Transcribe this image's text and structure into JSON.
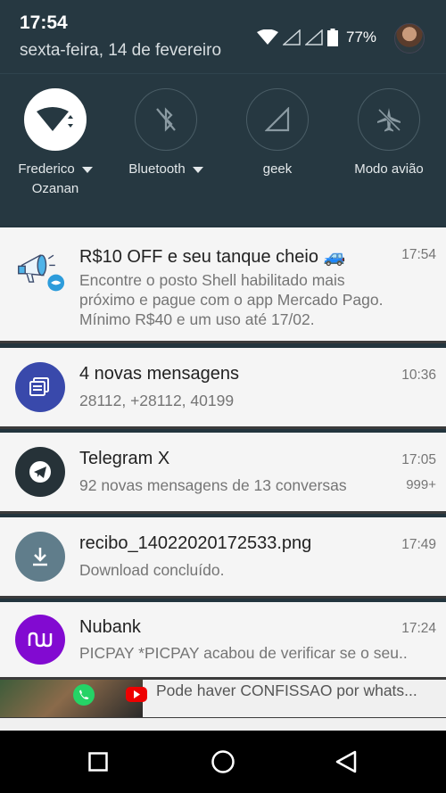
{
  "status_bar": {
    "time": "17:54",
    "date": "sexta-feira, 14 de fevereiro",
    "battery": "77%"
  },
  "quick_settings": {
    "tiles": [
      {
        "label": "Frederico",
        "sublabel": "Ozanan",
        "icon": "wifi-icon",
        "active": true,
        "expandable": true
      },
      {
        "label": "Bluetooth",
        "icon": "bluetooth-off-icon",
        "active": false,
        "expandable": true
      },
      {
        "label": "geek",
        "icon": "cell-signal-icon",
        "active": false,
        "expandable": false
      },
      {
        "label": "Modo avião",
        "icon": "airplane-icon",
        "active": false,
        "expandable": false
      }
    ]
  },
  "notifications": [
    {
      "title": "R$10 OFF e seu tanque cheio 🚙",
      "body": [
        "Encontre o posto Shell habilitado mais",
        "próximo e pague com o app Mercado Pago.",
        "Mínimo R$40 e um uso até 17/02."
      ],
      "time": "17:54",
      "icon": "megaphone-icon"
    },
    {
      "title": "4 novas mensagens",
      "body": "28112, +28112, 40199",
      "time": "10:36",
      "icon": "messages-icon",
      "icon_color": "#3949ab"
    },
    {
      "title": "Telegram X",
      "body": "92 novas mensagens de 13 conversas",
      "time": "17:05",
      "count": "999+",
      "icon": "telegram-icon",
      "icon_color": "#263238"
    },
    {
      "title": "recibo_14022020172533.png",
      "body": "Download concluído.",
      "time": "17:49",
      "icon": "download-icon",
      "icon_color": "#607d8b"
    },
    {
      "title": "Nubank",
      "body": "PICPAY *PICPAY acabou de verificar se o seu..",
      "time": "17:24",
      "icon": "nubank-icon",
      "icon_color": "#820ad1"
    },
    {
      "body": "Pode haver CONFISSAO por whats...",
      "icon": "whatsapp-icon"
    }
  ],
  "nav_bar": {
    "buttons": [
      "recents-button",
      "home-button",
      "back-button"
    ]
  }
}
